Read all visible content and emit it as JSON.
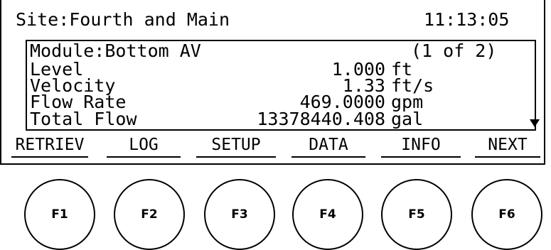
{
  "screen": {
    "site": "Site:Fourth and Main",
    "time": "11:13:05",
    "module": "Module:Bottom AV",
    "pager": "(1 of 2)",
    "readings": [
      {
        "label": "Level",
        "value": "1.000",
        "unit": "ft"
      },
      {
        "label": "Velocity",
        "value": "1.33",
        "unit": "ft/s"
      },
      {
        "label": "Flow Rate",
        "value": "469.0000",
        "unit": "gpm"
      },
      {
        "label": "Total Flow",
        "value": "13378440.408",
        "unit": "gal"
      }
    ],
    "more_indicator": "down-arrow-icon"
  },
  "softkeys": [
    "RETRIEV",
    "LOG",
    "SETUP",
    "DATA",
    "INFO",
    "NEXT"
  ],
  "function_keys": [
    "F1",
    "F2",
    "F3",
    "F4",
    "F5",
    "F6"
  ]
}
